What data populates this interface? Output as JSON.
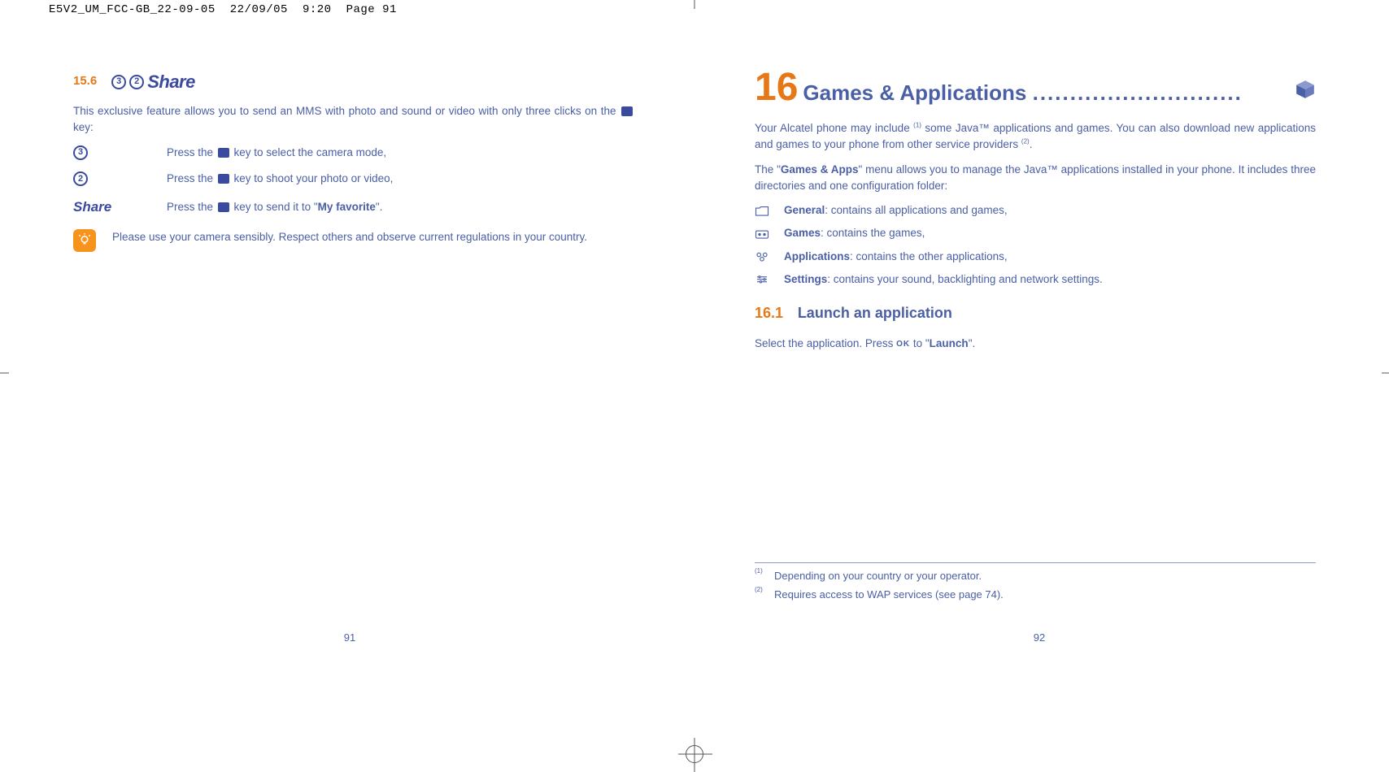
{
  "header": {
    "filename": "E5V2_UM_FCC-GB_22-09-05",
    "date": "22/09/05",
    "time": "9:20",
    "pageref": "Page 91"
  },
  "left": {
    "section_num": "15.6",
    "share_logo_text": "Share",
    "intro_pre": "This exclusive feature allows you to send an MMS with photo and sound or video with only three clicks on the ",
    "intro_post": " key:",
    "step1_pre": "Press the ",
    "step1_post": " key to select the camera mode,",
    "step2_pre": "Press the ",
    "step2_post": " key to shoot your photo or video,",
    "step3_pre": "Press the ",
    "step3_mid": " key to send it to \"",
    "step3_bold": "My favorite",
    "step3_post": "\".",
    "share_word": "Share",
    "tip": "Please use your camera sensibly. Respect others and observe current regulations in your country.",
    "page_num": "91"
  },
  "right": {
    "chapter_num": "16",
    "chapter_title": "Games & Applications ",
    "chapter_dots": "............................",
    "intro_p1a": "Your Alcatel phone may include ",
    "intro_p1b": " some Java™ applications and games. You can also download new applications and games to your phone from other service providers ",
    "intro_p1c": ".",
    "intro_p2a": "The \"",
    "intro_p2_bold": "Games & Apps",
    "intro_p2b": "\" menu allows you to manage the Java™ applications installed in your phone. It includes three directories and one configuration folder:",
    "dirs": [
      {
        "name": "General",
        "desc": ": contains all applications and games,"
      },
      {
        "name": "Games",
        "desc": ": contains the games,"
      },
      {
        "name": "Applications",
        "desc": ": contains the other applications,"
      },
      {
        "name": "Settings",
        "desc": ": contains your sound, backlighting and network settings."
      }
    ],
    "sub_num": "16.1",
    "sub_title": "Launch an application",
    "launch_pre": "Select the application. Press ",
    "launch_mid": " to \"",
    "launch_bold": "Launch",
    "launch_post": "\".",
    "fn1_marker": "(1)",
    "fn1": "Depending on your country or your operator.",
    "fn2_marker": "(2)",
    "fn2": "Requires access to WAP services (see page 74).",
    "page_num": "92"
  }
}
